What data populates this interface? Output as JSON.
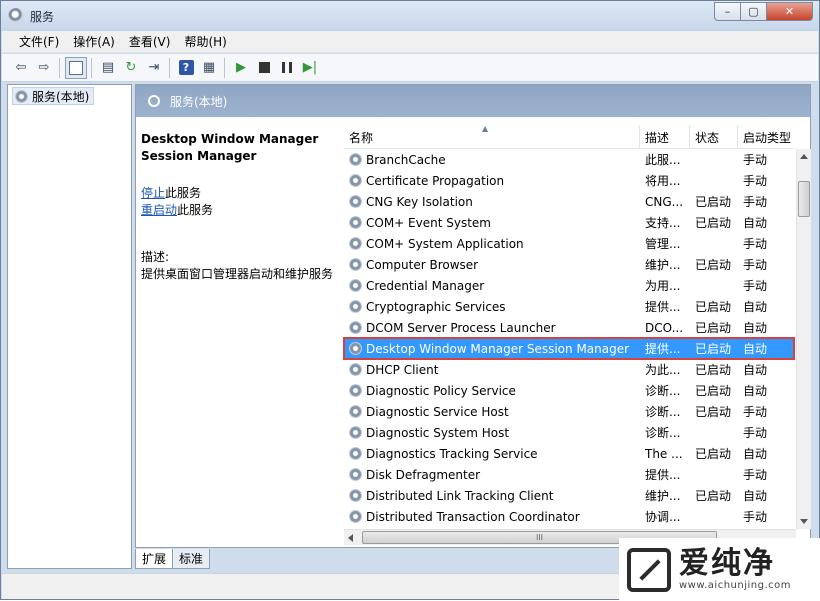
{
  "window": {
    "title": "服务"
  },
  "menu": [
    {
      "label": "文件(F)"
    },
    {
      "label": "操作(A)"
    },
    {
      "label": "查看(V)"
    },
    {
      "label": "帮助(H)"
    }
  ],
  "tree": {
    "root_label": "服务(本地)"
  },
  "main": {
    "header_title": "服务(本地)"
  },
  "details": {
    "service_name": "Desktop Window Manager Session Manager",
    "stop_link": "停止",
    "stop_suffix": "此服务",
    "restart_link": "重启动",
    "restart_suffix": "此服务",
    "desc_label": "描述:",
    "desc_text": "提供桌面窗口管理器启动和维护服务"
  },
  "list": {
    "columns": {
      "name": "名称",
      "desc": "描述",
      "status": "状态",
      "startup": "启动类型"
    },
    "rows": [
      {
        "name": "BranchCache",
        "desc": "此服...",
        "status": "",
        "startup": "手动"
      },
      {
        "name": "Certificate Propagation",
        "desc": "将用...",
        "status": "",
        "startup": "手动"
      },
      {
        "name": "CNG Key Isolation",
        "desc": "CNG...",
        "status": "已启动",
        "startup": "手动"
      },
      {
        "name": "COM+ Event System",
        "desc": "支持...",
        "status": "已启动",
        "startup": "自动"
      },
      {
        "name": "COM+ System Application",
        "desc": "管理...",
        "status": "",
        "startup": "手动"
      },
      {
        "name": "Computer Browser",
        "desc": "维护...",
        "status": "已启动",
        "startup": "手动"
      },
      {
        "name": "Credential Manager",
        "desc": "为用...",
        "status": "",
        "startup": "手动"
      },
      {
        "name": "Cryptographic Services",
        "desc": "提供...",
        "status": "已启动",
        "startup": "自动"
      },
      {
        "name": "DCOM Server Process Launcher",
        "desc": "DCO...",
        "status": "已启动",
        "startup": "自动"
      },
      {
        "name": "Desktop Window Manager Session Manager",
        "desc": "提供...",
        "status": "已启动",
        "startup": "自动"
      },
      {
        "name": "DHCP Client",
        "desc": "为此...",
        "status": "已启动",
        "startup": "自动"
      },
      {
        "name": "Diagnostic Policy Service",
        "desc": "诊断...",
        "status": "已启动",
        "startup": "自动"
      },
      {
        "name": "Diagnostic Service Host",
        "desc": "诊断...",
        "status": "已启动",
        "startup": "手动"
      },
      {
        "name": "Diagnostic System Host",
        "desc": "诊断...",
        "status": "",
        "startup": "手动"
      },
      {
        "name": "Diagnostics Tracking Service",
        "desc": "The ...",
        "status": "已启动",
        "startup": "自动"
      },
      {
        "name": "Disk Defragmenter",
        "desc": "提供...",
        "status": "",
        "startup": "手动"
      },
      {
        "name": "Distributed Link Tracking Client",
        "desc": "维护...",
        "status": "已启动",
        "startup": "自动"
      },
      {
        "name": "Distributed Transaction Coordinator",
        "desc": "协调...",
        "status": "",
        "startup": "手动"
      }
    ],
    "selected_index": 9,
    "hscroll_label": "III"
  },
  "tabs": [
    {
      "label": "扩展"
    },
    {
      "label": "标准"
    }
  ],
  "watermark": {
    "brand": "爱纯净",
    "url": "www.aichunjing.com"
  },
  "icons": {
    "back": "back-arrow-icon",
    "forward": "forward-arrow-icon",
    "help": "help-icon",
    "play": "play-icon",
    "stop": "stop-icon",
    "pause": "pause-icon",
    "resume": "resume-icon"
  },
  "colors": {
    "selection": "#3399ff",
    "highlight_border": "#d7423a",
    "header": "#9db2cd"
  }
}
